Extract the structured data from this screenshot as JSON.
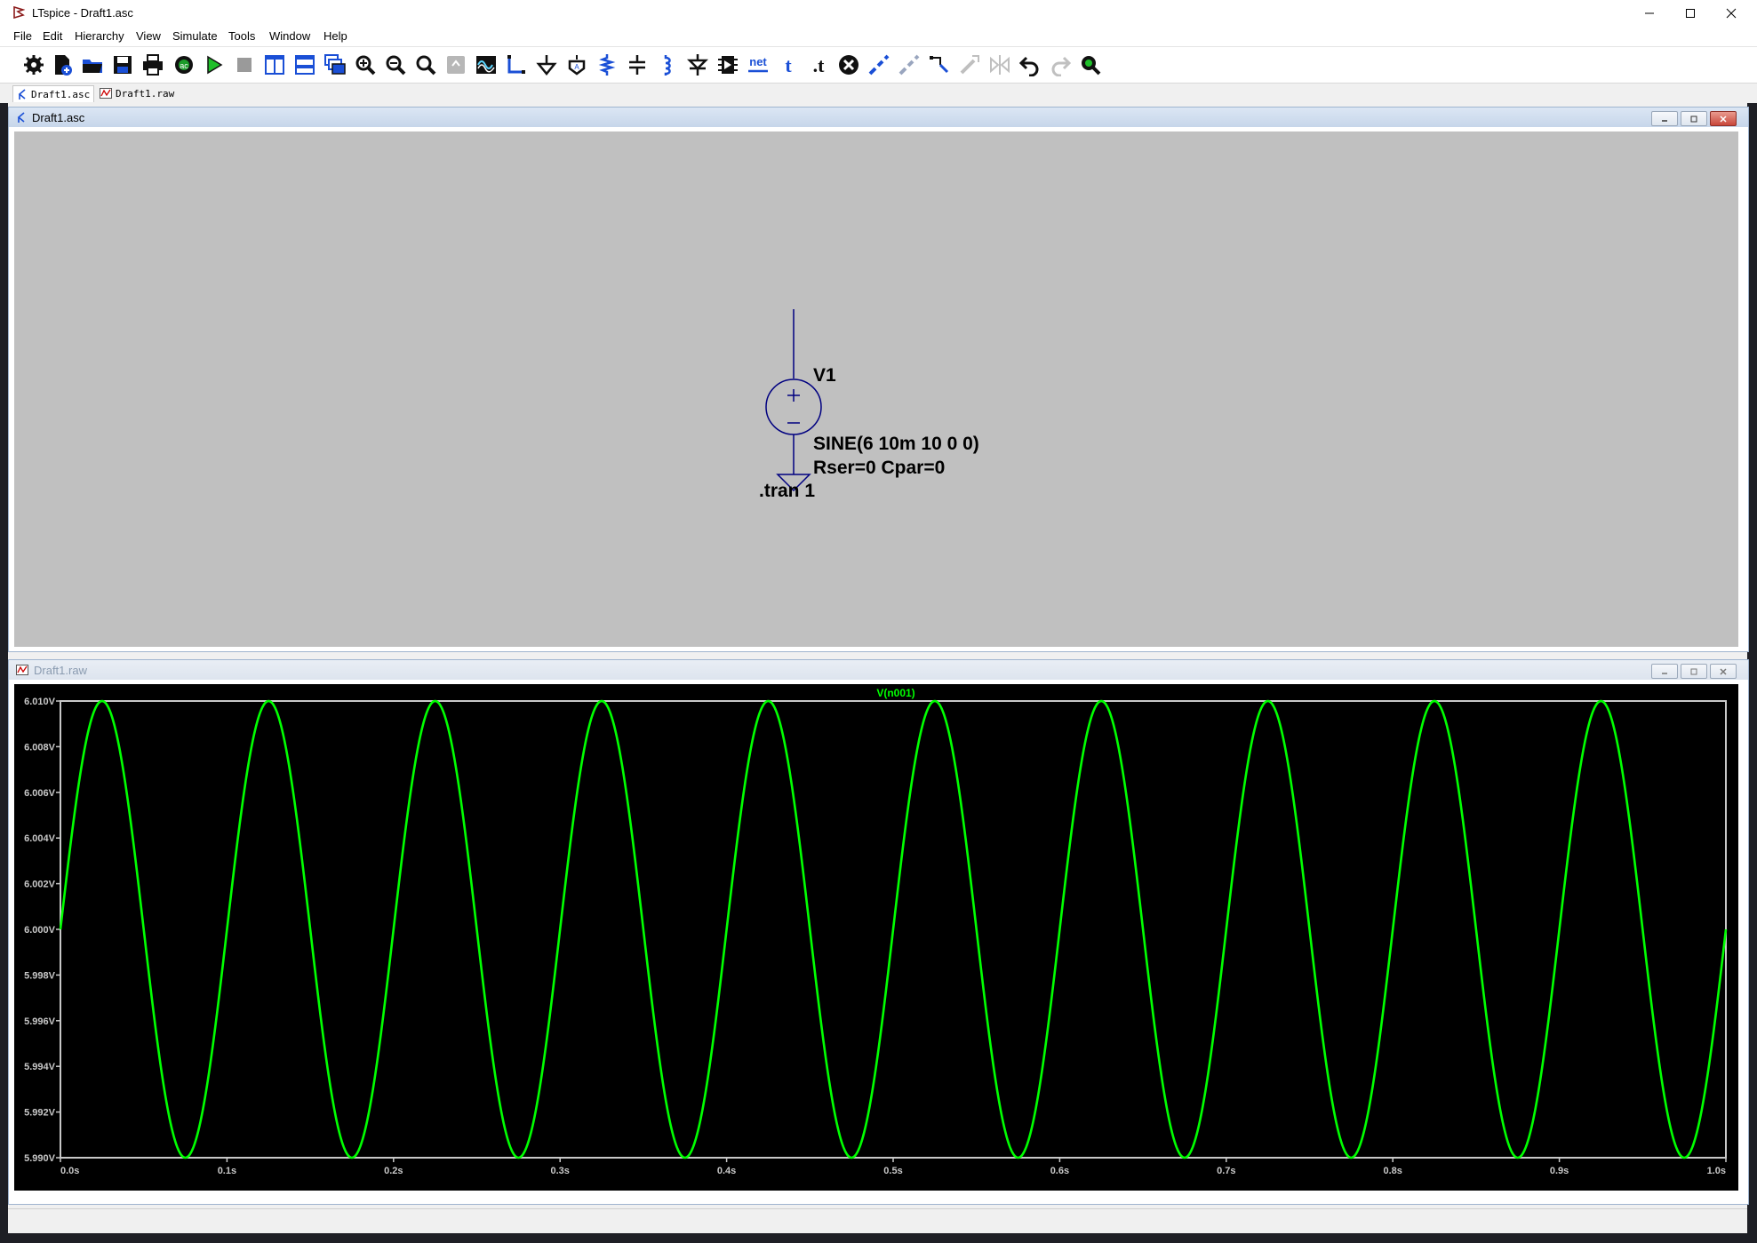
{
  "window": {
    "title": "LTspice - Draft1.asc",
    "minimize_icon": "minimize-icon",
    "maximize_icon": "maximize-icon",
    "close_icon": "close-icon"
  },
  "menu": [
    "File",
    "Edit",
    "Hierarchy",
    "View",
    "Simulate",
    "Tools",
    "Window",
    "Help"
  ],
  "toolbar": {
    "buttons": [
      "settings",
      "new-schematic",
      "open",
      "save",
      "print",
      "simulate-ac",
      "run",
      "halt",
      "tile-vertical",
      "tile-horizontal",
      "cascade",
      "zoom-in",
      "zoom-out",
      "zoom-fit",
      "zoom-back",
      "autorange",
      "wire",
      "ground",
      "label-net",
      "resistor",
      "capacitor",
      "inductor",
      "diode",
      "component",
      "net-name",
      "text",
      "spice-directive",
      "delete",
      "duplicate",
      "move",
      "drag",
      "rotate",
      "mirror",
      "undo",
      "redo",
      "find"
    ],
    "net_label": "net",
    "text_label": "t",
    "directive_label": ".t"
  },
  "tabs": [
    {
      "label": "Draft1.asc",
      "icon": "schematic-icon",
      "active": true
    },
    {
      "label": "Draft1.raw",
      "icon": "waveform-icon",
      "active": false
    }
  ],
  "schematic": {
    "title": "Draft1.asc",
    "source_name": "V1",
    "source_value": "SINE(6 10m 10 0 0)",
    "source_params": "Rser=0 Cpar=0",
    "directive": ".tran 1",
    "colors": {
      "canvas": "#c0c0c0",
      "wire": "#000080"
    }
  },
  "waveform": {
    "title": "Draft1.raw",
    "colors": {
      "background": "#000000",
      "trace": "#00ff00",
      "axis": "#c8c8c8"
    }
  },
  "chart_data": {
    "type": "line",
    "title": "V(n001)",
    "series": [
      {
        "name": "V(n001)",
        "function": "6 + 0.01*sin(2*pi*10*t)",
        "offset": 6,
        "amplitude": 0.01,
        "frequency_hz": 10
      }
    ],
    "x_ticks": [
      "0.0s",
      "0.1s",
      "0.2s",
      "0.3s",
      "0.4s",
      "0.5s",
      "0.6s",
      "0.7s",
      "0.8s",
      "0.9s",
      "1.0s"
    ],
    "y_ticks": [
      "6.010V",
      "6.008V",
      "6.006V",
      "6.004V",
      "6.002V",
      "6.000V",
      "5.998V",
      "5.996V",
      "5.994V",
      "5.992V",
      "5.990V"
    ],
    "xlim": [
      0,
      1
    ],
    "ylim": [
      5.99,
      6.01
    ],
    "grid": false
  }
}
